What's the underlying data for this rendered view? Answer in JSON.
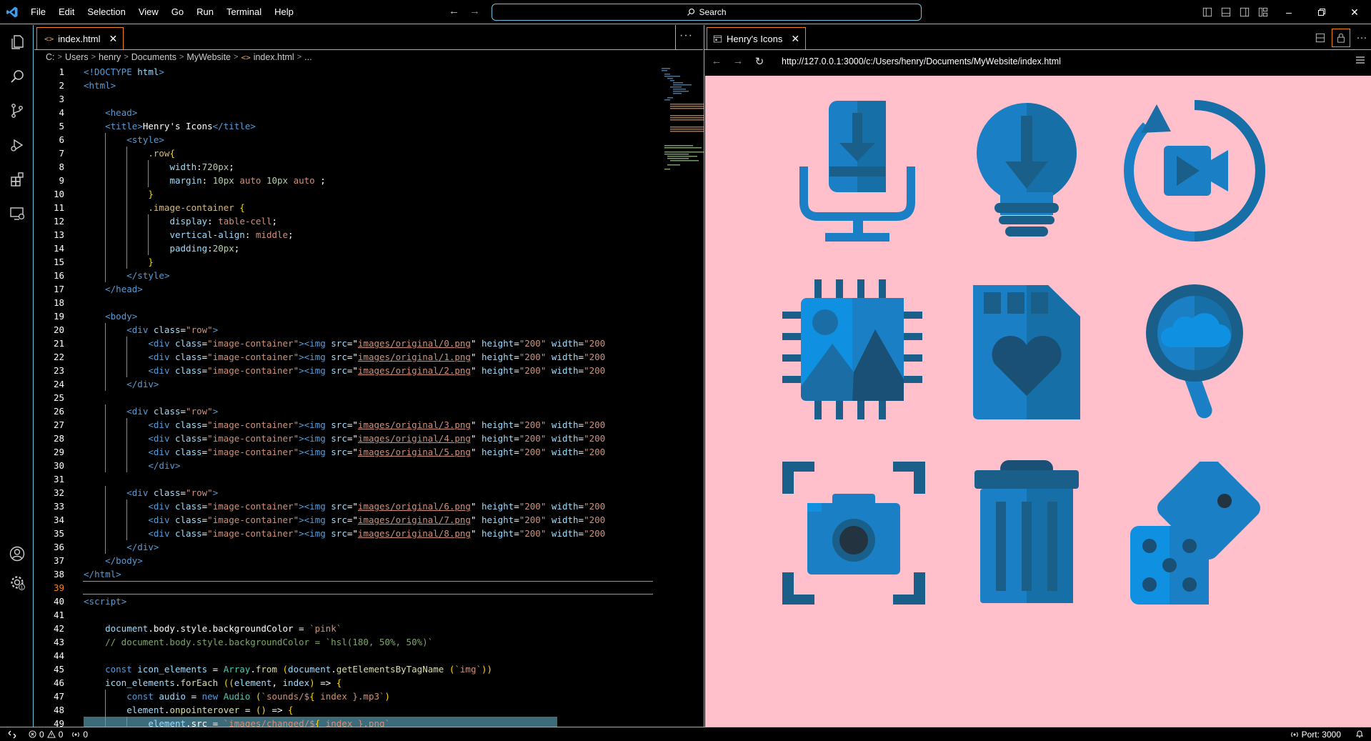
{
  "titlebar": {
    "menu": [
      "File",
      "Edit",
      "Selection",
      "View",
      "Go",
      "Run",
      "Terminal",
      "Help"
    ],
    "search_label": "Search"
  },
  "editor": {
    "tab_label": "index.html",
    "breadcrumb": [
      "C:",
      "Users",
      "henry",
      "Documents",
      "MyWebsite",
      "index.html",
      "..."
    ],
    "current_line": 39,
    "highlighted_line": 49
  },
  "code_lines": [
    "<!DOCTYPE html>",
    "<html>",
    "",
    "<head>",
    "<title>Henry's Icons</title>",
    "<style>",
    ".row{",
    "width:720px;",
    "margin: 10px auto 10px auto ;",
    "}",
    ".image-container {",
    "display: table-cell;",
    "vertical-align: middle;",
    "padding:20px;",
    "}",
    "</style>",
    "</head>",
    "",
    "<body>",
    "<div class=\"row\">",
    "<div class=\"image-container\"><img src=\"images/original/0.png\" height=\"200\" width=\"200",
    "<div class=\"image-container\"><img src=\"images/original/1.png\" height=\"200\" width=\"200",
    "<div class=\"image-container\"><img src=\"images/original/2.png\" height=\"200\" width=\"200",
    "</div>",
    "",
    "<div class=\"row\">",
    "<div class=\"image-container\"><img src=\"images/original/3.png\" height=\"200\" width=\"200",
    "<div class=\"image-container\"><img src=\"images/original/4.png\" height=\"200\" width=\"200",
    "<div class=\"image-container\"><img src=\"images/original/5.png\" height=\"200\" width=\"200",
    "</div>",
    "",
    "<div class=\"row\">",
    "<div class=\"image-container\"><img src=\"images/original/6.png\" height=\"200\" width=\"200",
    "<div class=\"image-container\"><img src=\"images/original/7.png\" height=\"200\" width=\"200",
    "<div class=\"image-container\"><img src=\"images/original/8.png\" height=\"200\" width=\"200",
    "</div>",
    "</body>",
    "</html>",
    "",
    "<script>",
    "",
    "document.body.style.backgroundColor = `pink`",
    "// document.body.style.backgroundColor = `hsl(180, 50%, 50%)`",
    "",
    "const icon_elements = Array.from (document.getElementsByTagName (`img`))",
    "icon_elements.forEach ((element, index) => {",
    "const audio = new Audio (`sounds/${ index }.mp3`)",
    "element.onpointerover = () => {",
    "element.src = `images/changed/${ index }.png`"
  ],
  "preview": {
    "tab_label": "Henry's Icons",
    "url": "http://127.0.0.1:3000/c:/Users/henry/Documents/MyWebsite/index.html",
    "page_background": "#ffc0cb",
    "icons": [
      "microphone-download-icon",
      "lightbulb-download-icon",
      "video-replay-icon",
      "image-chip-icon",
      "sd-card-heart-icon",
      "cloud-search-icon",
      "camera-focus-icon",
      "trash-can-icon",
      "dice-icon"
    ]
  },
  "statusbar": {
    "errors": "0",
    "warnings": "0",
    "ports": "0",
    "live_server": "Port: 3000"
  },
  "colors": {
    "contrast_border": "#6fc3df",
    "focus_border": "#f38518",
    "icon_blue": "#1a7fc4"
  }
}
